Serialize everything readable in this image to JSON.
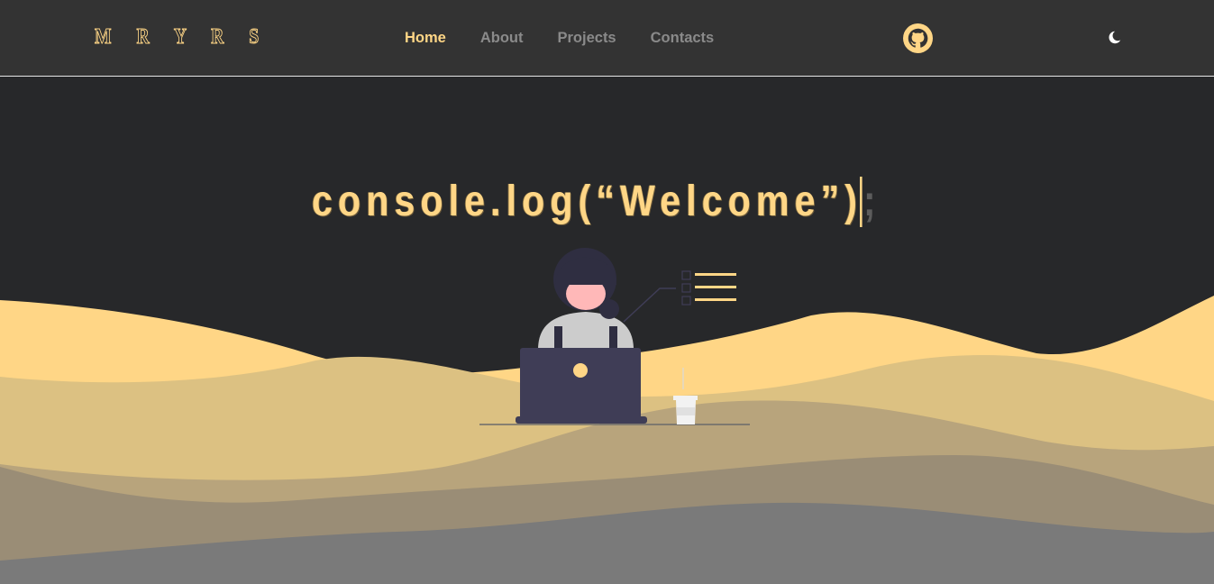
{
  "header": {
    "logo": "M R Y R S",
    "nav": [
      {
        "label": "Home",
        "active": true
      },
      {
        "label": "About",
        "active": false
      },
      {
        "label": "Projects",
        "active": false
      },
      {
        "label": "Contacts",
        "active": false
      }
    ],
    "github_icon": "github-icon",
    "theme_icon": "moon-icon"
  },
  "hero": {
    "typed": "console.log(“Welcome”)",
    "rest": ";"
  },
  "colors": {
    "accent": "#ffd686",
    "header_bg": "#333333",
    "page_bg": "#27282a",
    "nav_inactive": "#8a8a8a",
    "wave1": "#ffd686",
    "wave2": "#dcc182",
    "wave3": "#b8a47c",
    "wave4": "#9a8d76",
    "wave5": "#7a7a7a"
  }
}
